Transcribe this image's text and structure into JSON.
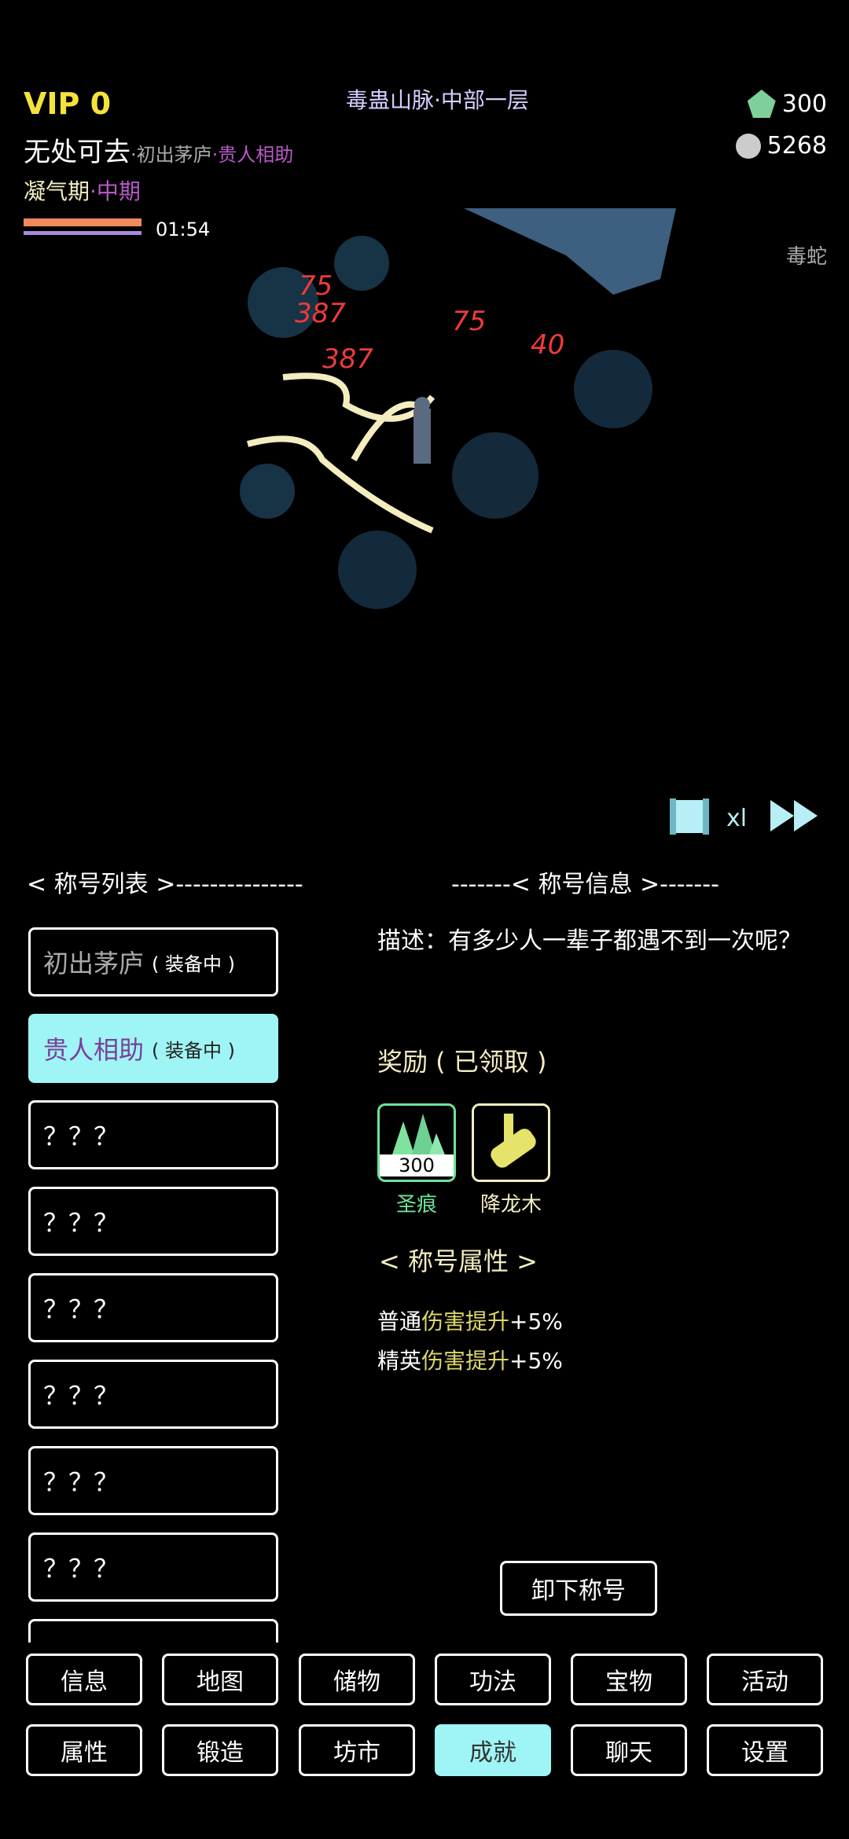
{
  "header": {
    "vip": "VIP 0",
    "location": "毒蛊山脉·中部一层",
    "player_name": "无处可去",
    "title_sub1": "·初出茅庐",
    "title_sub2": "·贵人相助",
    "realm": "凝气期",
    "realm_stage": "·中期",
    "timer": "01:54",
    "currency_gems": "300",
    "currency_stones": "5268",
    "enemy_name": "毒蛇"
  },
  "battle": {
    "damage_numbers": [
      "75",
      "387",
      "75",
      "387",
      "40"
    ],
    "speed_label": "xl"
  },
  "titles_panel": {
    "list_heading": "< 称号列表 >---------------",
    "info_heading": "-------< 称号信息 >-------",
    "items": [
      {
        "label": "初出茅庐",
        "tag": "( 装备中 )"
      },
      {
        "label": "贵人相助",
        "tag": "( 装备中 )"
      },
      {
        "label": "？？？"
      },
      {
        "label": "？？？"
      },
      {
        "label": "？？？"
      },
      {
        "label": "？？？"
      },
      {
        "label": "？？？"
      },
      {
        "label": "？？？"
      }
    ]
  },
  "title_info": {
    "description": "描述：有多少人一辈子都遇不到一次呢？",
    "reward_heading": "奖励 ( 已领取 )",
    "rewards": [
      {
        "name": "圣痕",
        "count": "300",
        "color": "#6ee39a"
      },
      {
        "name": "降龙木",
        "color": "#f3edc0"
      }
    ],
    "props_heading": "< 称号属性 >",
    "props": [
      {
        "prefix": "普通",
        "stat": "伤害提升",
        "value": "+5%"
      },
      {
        "prefix": "精英",
        "stat": "伤害提升",
        "value": "+5%"
      }
    ],
    "unequip_label": "卸下称号"
  },
  "nav": {
    "row1": [
      "信息",
      "地图",
      "储物",
      "功法",
      "宝物",
      "活动"
    ],
    "row2": [
      "属性",
      "锻造",
      "坊市",
      "成就",
      "聊天",
      "设置"
    ],
    "active": "成就"
  },
  "colors": {
    "selected_bg": "#9ff5f5",
    "vip": "#f5e23a",
    "highlight": "#dcd66a",
    "purple": "#b659c6"
  }
}
